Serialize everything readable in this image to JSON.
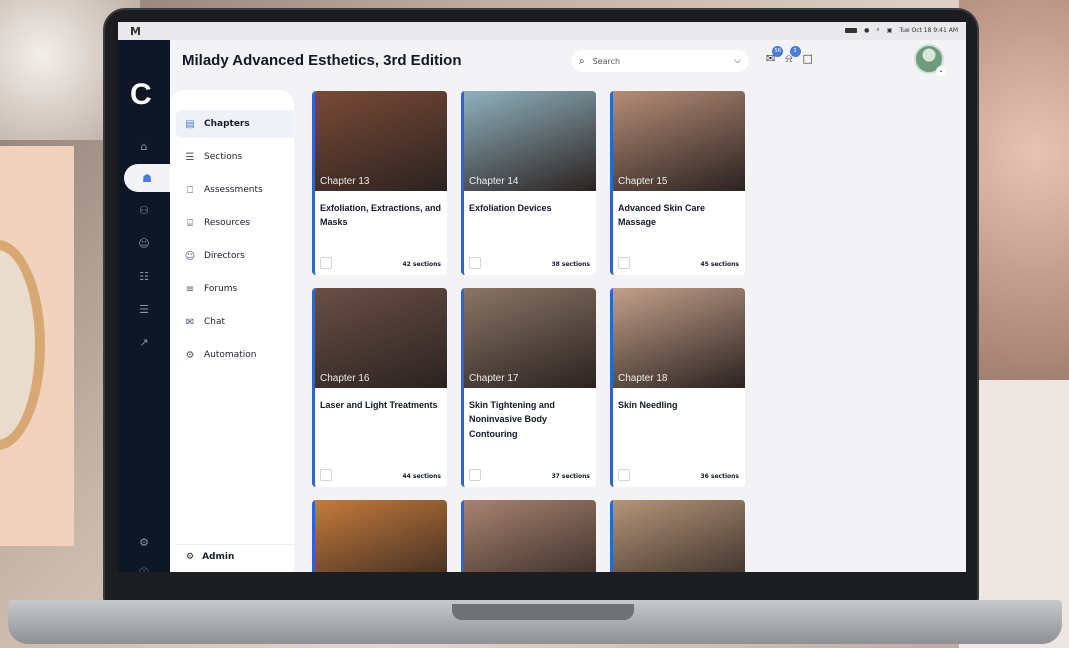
{
  "app": {
    "logo_letter": "C",
    "menubar_logo": "M",
    "menubar_time": "Tue Oct 18  9:41 AM"
  },
  "header": {
    "title": "Milady Advanced Esthetics, 3rd Edition"
  },
  "search": {
    "placeholder": "Search"
  },
  "notifications": {
    "messages_count": "56",
    "alerts_count": "3"
  },
  "rail": {
    "icons": [
      "home-icon",
      "chapters-icon",
      "groups-icon",
      "user-icon",
      "org-chart-icon",
      "library-icon",
      "analytics-icon",
      "settings-icon",
      "help-icon"
    ]
  },
  "subnav": {
    "items": [
      {
        "label": "Chapters",
        "icon": "book-icon"
      },
      {
        "label": "Sections",
        "icon": "list-icon"
      },
      {
        "label": "Assessments",
        "icon": "document-icon"
      },
      {
        "label": "Resources",
        "icon": "library-icon"
      },
      {
        "label": "Directors",
        "icon": "user-icon"
      },
      {
        "label": "Forums",
        "icon": "list-icon"
      },
      {
        "label": "Chat",
        "icon": "chat-icon"
      },
      {
        "label": "Automation",
        "icon": "gears-icon"
      }
    ],
    "admin_label": "Admin"
  },
  "cards": [
    {
      "chapter": "Chapter 13",
      "title": "Exfoliation, Extractions, and Masks",
      "sections": "42 sections",
      "color": "#7a4a36"
    },
    {
      "chapter": "Chapter 14",
      "title": "Exfoliation Devices",
      "sections": "38 sections",
      "color": "#8fb2bf"
    },
    {
      "chapter": "Chapter 15",
      "title": "Advanced Skin Care Massage",
      "sections": "45 sections",
      "color": "#b68d77"
    },
    {
      "chapter": "Chapter 16",
      "title": "Laser and Light Treatments",
      "sections": "44 sections",
      "color": "#6a4f45"
    },
    {
      "chapter": "Chapter 17",
      "title": "Skin Tightening and Noninvasive Body Contouring",
      "sections": "37 sections",
      "color": "#8a7565"
    },
    {
      "chapter": "Chapter 18",
      "title": "Skin Needling",
      "sections": "36 sections",
      "color": "#c3a08a"
    },
    {
      "color": "#c57a3a"
    },
    {
      "color": "#a88370"
    },
    {
      "color": "#b59578"
    }
  ]
}
